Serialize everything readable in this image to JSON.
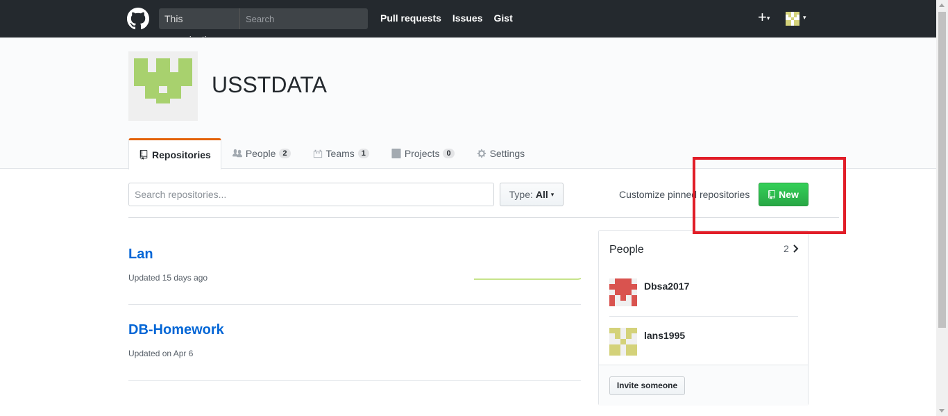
{
  "header": {
    "search_scope": "This organization",
    "search_placeholder": "Search",
    "nav": [
      "Pull requests",
      "Issues",
      "Gist"
    ],
    "plus_label": "+",
    "caret": "▾"
  },
  "org": {
    "name": "USSTDATA",
    "avatar_color": "#a8d16e"
  },
  "tabs": [
    {
      "label": "Repositories",
      "icon": "repo-icon",
      "counter": null
    },
    {
      "label": "People",
      "icon": "people-icon",
      "counter": "2"
    },
    {
      "label": "Teams",
      "icon": "teams-icon",
      "counter": "1"
    },
    {
      "label": "Projects",
      "icon": "projects-icon",
      "counter": "0"
    },
    {
      "label": "Settings",
      "icon": "gear-icon",
      "counter": null
    }
  ],
  "filter": {
    "placeholder": "Search repositories...",
    "type_label": "Type:",
    "type_value": "All",
    "customize": "Customize pinned repositories",
    "new_label": "New"
  },
  "repos": [
    {
      "name": "Lan",
      "updated": "Updated 15 days ago"
    },
    {
      "name": "DB-Homework",
      "updated": "Updated on Apr 6"
    }
  ],
  "people": {
    "title": "People",
    "count": "2",
    "members": [
      {
        "login": "Dbsa2017",
        "avatar_color": "#d9534f"
      },
      {
        "login": "lans1995",
        "avatar_color": "#d4d27a"
      }
    ],
    "invite_label": "Invite someone"
  },
  "colors": {
    "header_bg": "#24292e",
    "link": "#0366d6",
    "new_button": "#28a745",
    "tab_accent": "#e36209",
    "highlight_box": "#e11d28"
  }
}
